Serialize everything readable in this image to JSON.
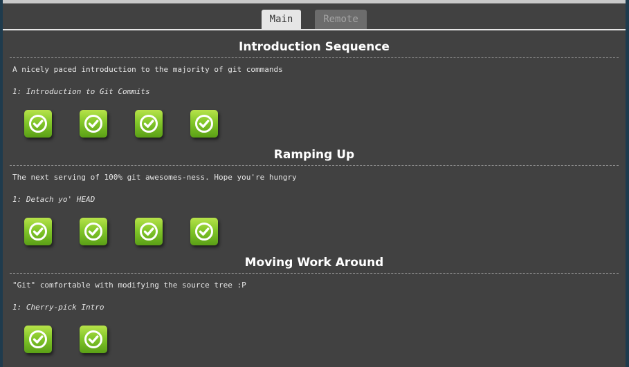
{
  "tabs": [
    {
      "label": "Main",
      "active": true
    },
    {
      "label": "Remote",
      "active": false
    }
  ],
  "sequences": [
    {
      "title": "Introduction Sequence",
      "about": "A nicely paced introduction to the majority of git commands",
      "level_name": "1: Introduction to Git Commits",
      "levels_completed": 4,
      "levels_total": 4
    },
    {
      "title": "Ramping Up",
      "about": "The next serving of 100% git awesomes-ness. Hope you're hungry",
      "level_name": "1: Detach yo' HEAD",
      "levels_completed": 4,
      "levels_total": 4
    },
    {
      "title": "Moving Work Around",
      "about": "\"Git\" comfortable with modifying the source tree :P",
      "level_name": "1: Cherry-pick Intro",
      "levels_completed": 2,
      "levels_total": 2
    }
  ],
  "icons": {
    "level_complete": "check-circle-icon"
  },
  "colors": {
    "background": "#414141",
    "tab_active": "#e6e6e6",
    "tab_inactive": "#6c6c6c",
    "level_green": "#83c72a"
  }
}
